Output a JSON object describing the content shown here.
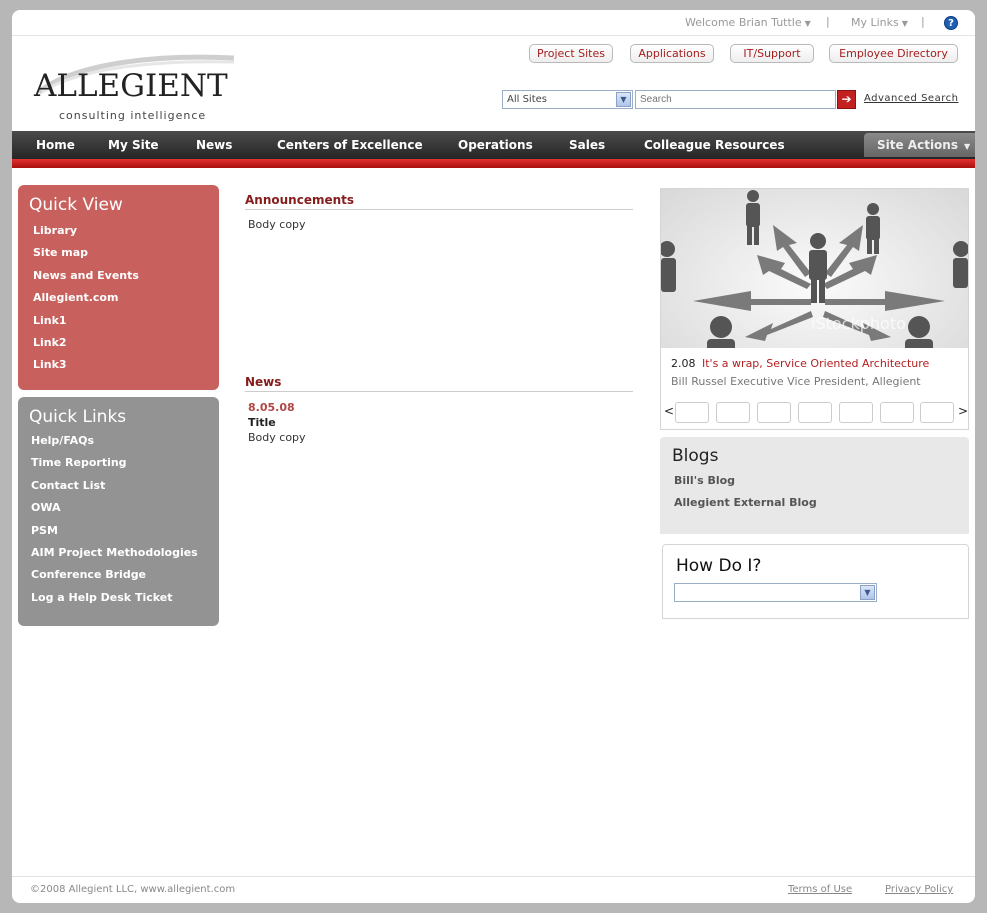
{
  "utility": {
    "welcome": "Welcome Brian Tuttle",
    "my_links": "My Links",
    "help": "?"
  },
  "header": {
    "logo_name": "ALLEGIENT",
    "logo_tagline": "consulting intelligence",
    "buttons": [
      "Project Sites",
      "Applications",
      "IT/Support",
      "Employee Directory"
    ],
    "scope_selected": "All Sites",
    "search_placeholder": "Search",
    "advanced_search": "Advanced Search"
  },
  "nav": {
    "items": [
      "Home",
      "My Site",
      "News",
      "Centers of Excellence",
      "Operations",
      "Sales",
      "Colleague Resources"
    ],
    "site_actions": "Site Actions"
  },
  "quick_view": {
    "title": "Quick View",
    "links": [
      "Library",
      "Site map",
      "News and Events",
      "Allegient.com",
      "Link1",
      "Link2",
      "Link3"
    ]
  },
  "quick_links": {
    "title": "Quick Links",
    "links": [
      "Help/FAQs",
      "Time Reporting",
      "Contact List",
      "OWA",
      "PSM",
      "AIM Project Methodologies",
      "Conference Bridge",
      "Log a Help Desk Ticket"
    ]
  },
  "announcements": {
    "title": "Announcements",
    "body": "Body copy"
  },
  "news": {
    "title": "News",
    "date": "8.05.08",
    "item_title": "Title",
    "body": "Body copy"
  },
  "feature": {
    "watermark": "iStockphoto",
    "date": "2.08",
    "link": "It's a wrap, Service Oriented Architecture",
    "byline": "Bill Russel Executive Vice President, Allegient",
    "prev": "<",
    "next": ">"
  },
  "blogs": {
    "title": "Blogs",
    "links": [
      "Bill's Blog",
      "Allegient External Blog"
    ]
  },
  "howdoi": {
    "title": "How Do I?"
  },
  "footer": {
    "copyright": "©2008 Allegient LLC, www.allegient.com",
    "terms": "Terms of Use",
    "privacy": "Privacy Policy"
  },
  "colors": {
    "accent_red": "#c32020",
    "quick_view_bg": "#c8605e",
    "quick_links_bg": "#939393",
    "nav_bg": "#333333"
  }
}
